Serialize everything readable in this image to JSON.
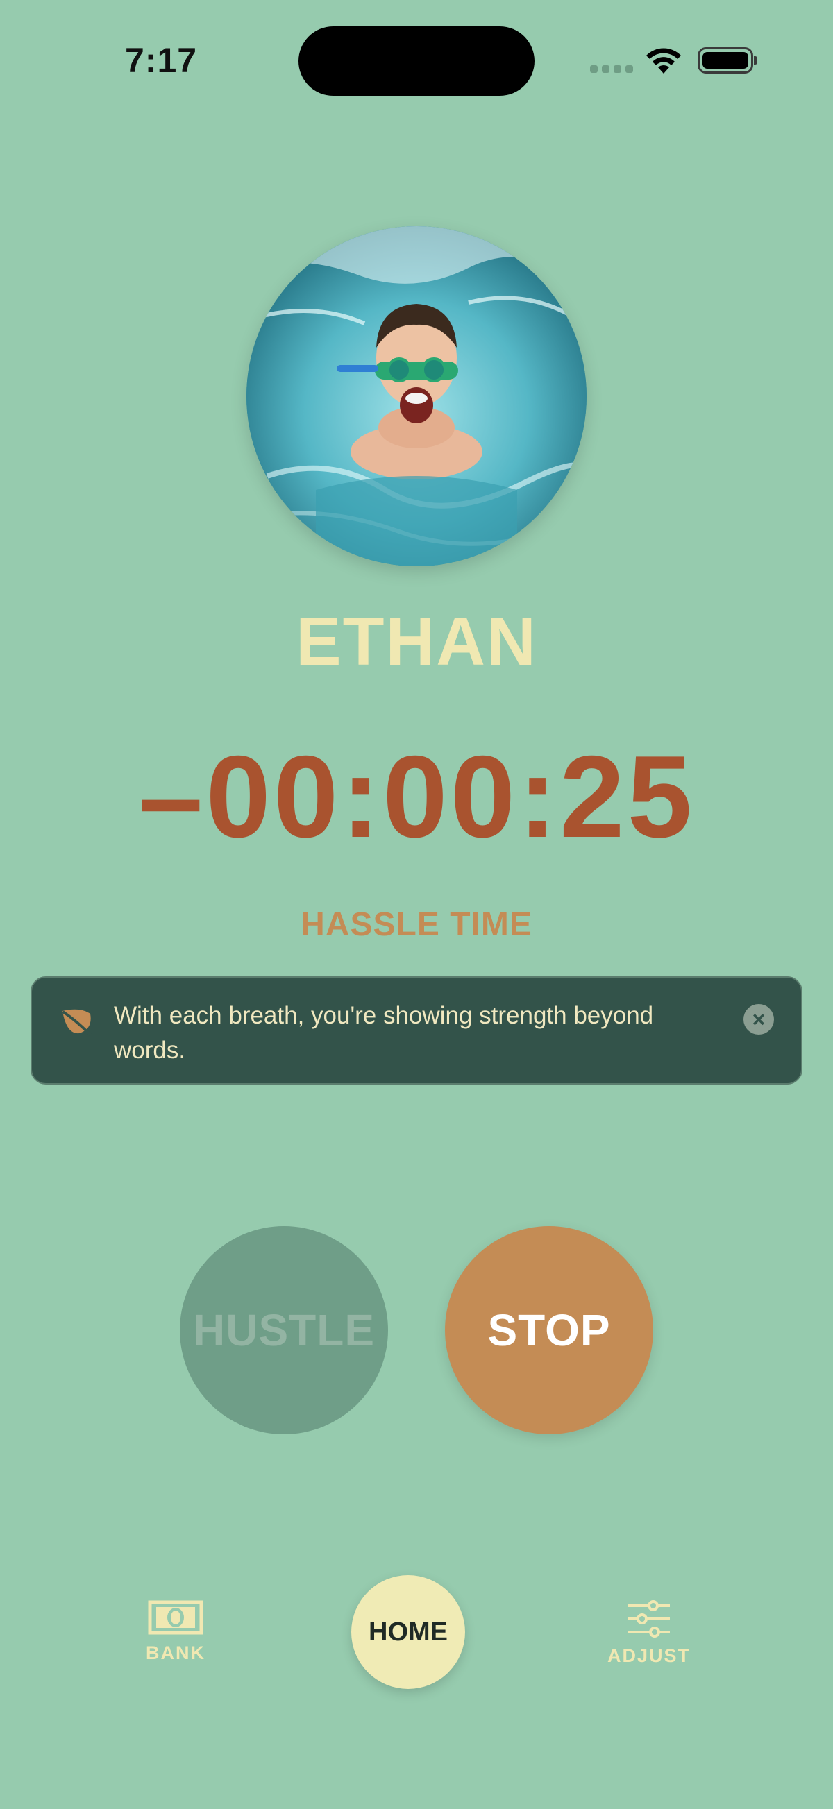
{
  "status_bar": {
    "time": "7:17",
    "wifi_icon": "wifi-icon",
    "battery_icon": "battery-full-icon"
  },
  "profile": {
    "name": "ETHAN",
    "photo": "child-swimming-photo"
  },
  "timer": {
    "value": "–00:00:25",
    "mode_label": "HASSLE TIME"
  },
  "banner": {
    "icon": "leaf-icon",
    "message": "With each breath, you're showing strength beyond words.",
    "close_icon": "close-icon"
  },
  "actions": {
    "hustle_label": "HUSTLE",
    "stop_label": "STOP"
  },
  "nav": {
    "bank_label": "BANK",
    "home_label": "HOME",
    "adjust_label": "ADJUST"
  },
  "colors": {
    "background": "#96cbae",
    "accent_orange": "#c48c55",
    "timer_red": "#a9532f",
    "cream": "#f0e8b2",
    "banner_bg": "#33534a"
  }
}
